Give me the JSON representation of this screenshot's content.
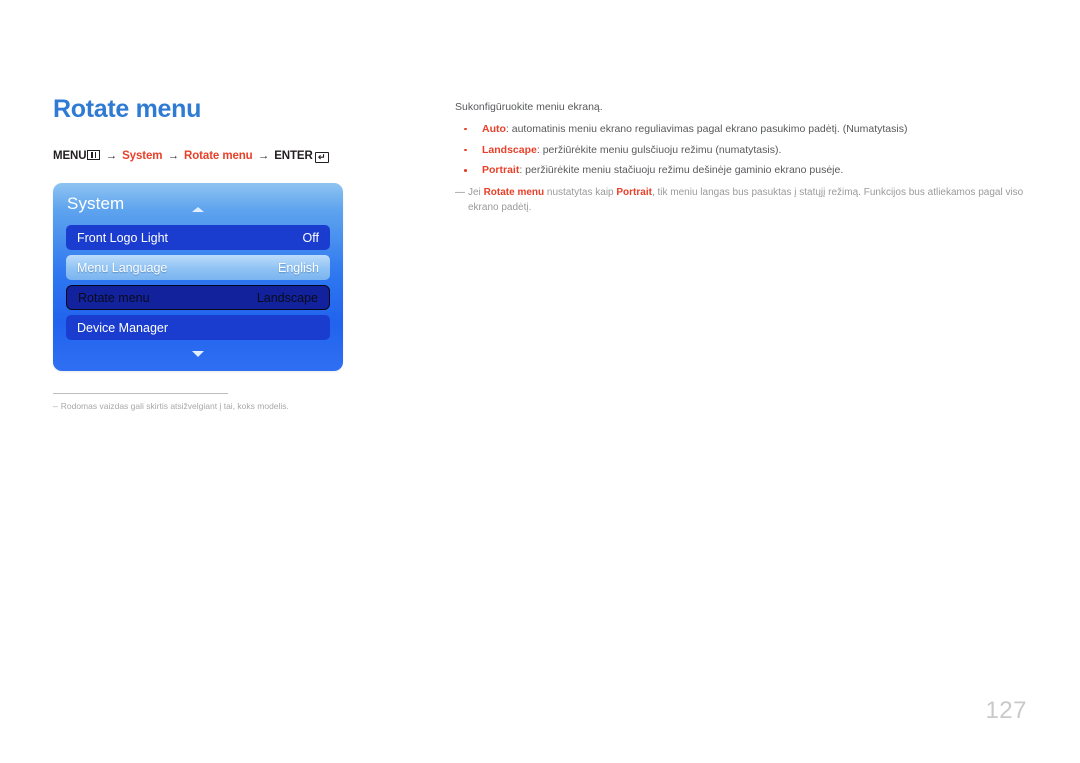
{
  "page": {
    "title": "Rotate menu",
    "number": "127",
    "accent_blue": "#2f7bd4",
    "accent_red": "#e8402a"
  },
  "breadcrumb": {
    "menu_label": "MENU",
    "menu_icon": "menu-bars-icon",
    "arrow": "→",
    "item1": "System",
    "item2": "Rotate menu",
    "enter_label": "ENTER",
    "enter_icon": "enter-return-icon",
    "enter_glyph": "↵"
  },
  "osd": {
    "title": "System",
    "scroll_up_icon": "chevron-up-icon",
    "scroll_down_icon": "chevron-down-icon",
    "rows": [
      {
        "label": "Front Logo Light",
        "value": "Off",
        "state": "plain"
      },
      {
        "label": "Menu Language",
        "value": "English",
        "state": "highlight"
      },
      {
        "label": "Rotate menu",
        "value": "Landscape",
        "state": "selected"
      },
      {
        "label": "Device Manager",
        "value": "",
        "state": "plain"
      }
    ]
  },
  "left_note": {
    "dash": "–",
    "text": "Rodomas vaizdas gali skirtis atsižvelgiant į tai, koks modelis."
  },
  "content": {
    "intro": "Sukonfigūruokite meniu ekraną.",
    "bullets": [
      {
        "keyword": "Auto",
        "text": ": automatinis meniu ekrano reguliavimas pagal ekrano pasukimo padėtį. (Numatytasis)"
      },
      {
        "keyword": "Landscape",
        "text": ": peržiūrėkite meniu gulsčiuoju režimu (numatytasis)."
      },
      {
        "keyword": "Portrait",
        "text": ": peržiūrėkite meniu stačiuoju režimu dešinėje gaminio ekrano pusėje."
      }
    ],
    "note": {
      "dash": "—",
      "part1": "Jei ",
      "kw1": "Rotate menu",
      "part2": " nustatytas kaip ",
      "kw2": "Portrait",
      "part3": ", tik meniu langas bus pasuktas į statųjį režimą. Funkcijos bus atliekamos pagal viso ekrano padėtį."
    }
  }
}
